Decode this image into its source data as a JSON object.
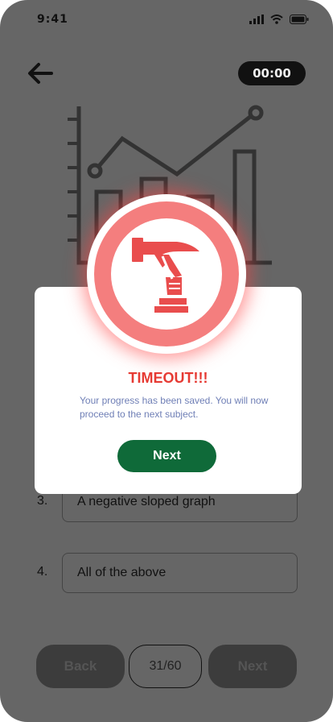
{
  "status_bar": {
    "time": "9:41"
  },
  "header": {
    "timer": "00:00"
  },
  "options": [
    {
      "number": "3.",
      "text": "A negative sloped graph"
    },
    {
      "number": "4.",
      "text": "All of  the above"
    }
  ],
  "footer": {
    "back_label": "Back",
    "page_counter": "31/60",
    "next_label": "Next"
  },
  "modal": {
    "title": "TIMEOUT!!!",
    "message": "Your progress has been saved. You will now proceed to the next subject.",
    "next_label": "Next"
  },
  "colors": {
    "accent_red": "#e63a33",
    "badge_red": "#f47e7e",
    "next_green": "#0f6a39",
    "message_blue": "#6f7fb6"
  },
  "icons": [
    "signal-icon",
    "wifi-icon",
    "battery-icon",
    "back-arrow-icon",
    "chart-illustration-icon",
    "timeout-hammer-icon"
  ]
}
